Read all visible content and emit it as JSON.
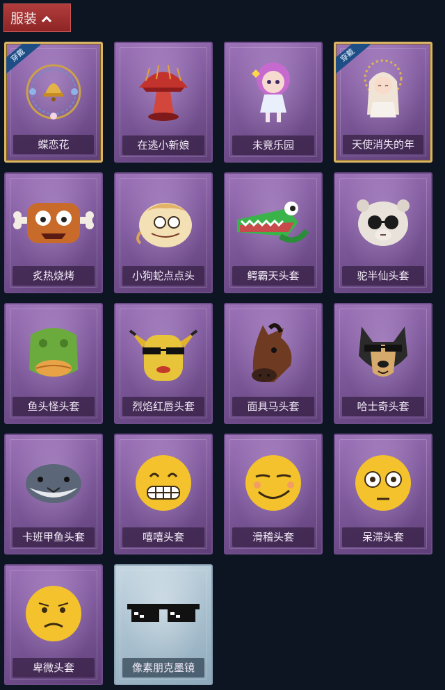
{
  "header": {
    "tab_label": "服装"
  },
  "badge_text": "穿戴",
  "items": [
    {
      "label": "蝶恋花",
      "equipped": true,
      "icon": "bell-wreath-icon"
    },
    {
      "label": "在逃小新娘",
      "equipped": false,
      "icon": "red-mushroom-dress-icon"
    },
    {
      "label": "未竟乐园",
      "equipped": false,
      "icon": "doll-figure-icon"
    },
    {
      "label": "天使消失的年",
      "equipped": true,
      "icon": "angel-doll-icon"
    },
    {
      "label": "炙热烧烤",
      "equipped": false,
      "icon": "meat-mask-icon"
    },
    {
      "label": "小狗蛇点点头",
      "equipped": false,
      "icon": "snake-dog-mask-icon"
    },
    {
      "label": "鳄霸天头套",
      "equipped": false,
      "icon": "crocodile-mask-icon"
    },
    {
      "label": "驼半仙头套",
      "equipped": false,
      "icon": "alpaca-mask-icon"
    },
    {
      "label": "鱼头怪头套",
      "equipped": false,
      "icon": "fish-mask-icon"
    },
    {
      "label": "烈焰红唇头套",
      "equipped": false,
      "icon": "yellow-mask-icon"
    },
    {
      "label": "面具马头套",
      "equipped": false,
      "icon": "horse-mask-icon"
    },
    {
      "label": "哈士奇头套",
      "equipped": false,
      "icon": "husky-mask-icon"
    },
    {
      "label": "卡班甲鱼头套",
      "equipped": false,
      "icon": "shark-mask-icon"
    },
    {
      "label": "嘻嘻头套",
      "equipped": false,
      "icon": "grin-emoji-icon"
    },
    {
      "label": "滑稽头套",
      "equipped": false,
      "icon": "smirk-emoji-icon"
    },
    {
      "label": "呆滞头套",
      "equipped": false,
      "icon": "stunned-emoji-icon"
    },
    {
      "label": "卑微头套",
      "equipped": false,
      "icon": "shy-emoji-icon"
    },
    {
      "label": "像素朋克墨镜",
      "equipped": false,
      "icon": "pixel-sunglasses-icon"
    }
  ]
}
